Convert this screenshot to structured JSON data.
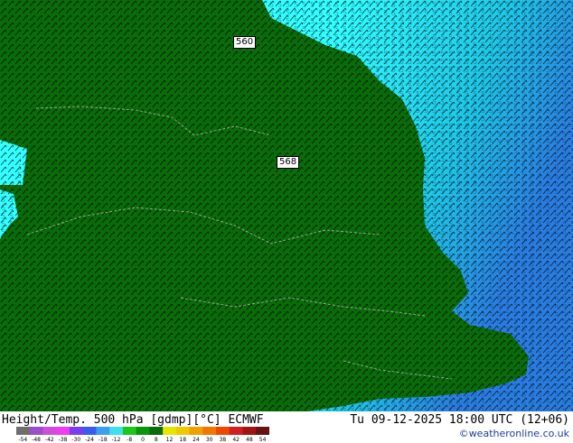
{
  "map": {
    "contour_labels": [
      {
        "text": "560"
      },
      {
        "text": "568"
      }
    ],
    "field_digits": [
      "5",
      "6",
      "7",
      "8",
      "9"
    ],
    "colors": {
      "land_green": "#0a6b0a",
      "sea_cyan": "#33ffff",
      "sea_mid": "#1ec8e6",
      "sea_deep": "#2a7de0",
      "barb": "#000000",
      "border": "#c8c8c8"
    }
  },
  "footer": {
    "title": "Height/Temp. 500 hPa [gdmp][°C] ECMWF",
    "datetime": "Tu 09-12-2025 18:00 UTC (12+06)",
    "credit": "©weatheronline.co.uk",
    "scale_ticks": [
      "-54",
      "-48",
      "-42",
      "-38",
      "-30",
      "-24",
      "-18",
      "-12",
      "-8",
      "0",
      "8",
      "12",
      "18",
      "24",
      "30",
      "38",
      "42",
      "48",
      "54"
    ],
    "scale_colors": [
      "#6e6e6e",
      "#9a4fc8",
      "#d04fd8",
      "#f03cf0",
      "#7a3cf0",
      "#3c5af0",
      "#3ca0f0",
      "#3ce0f0",
      "#19c819",
      "#0a960a",
      "#0a6b0a",
      "#e6e600",
      "#f0c800",
      "#f0a000",
      "#f07800",
      "#f04600",
      "#d21e1e",
      "#a01414",
      "#641414"
    ]
  }
}
